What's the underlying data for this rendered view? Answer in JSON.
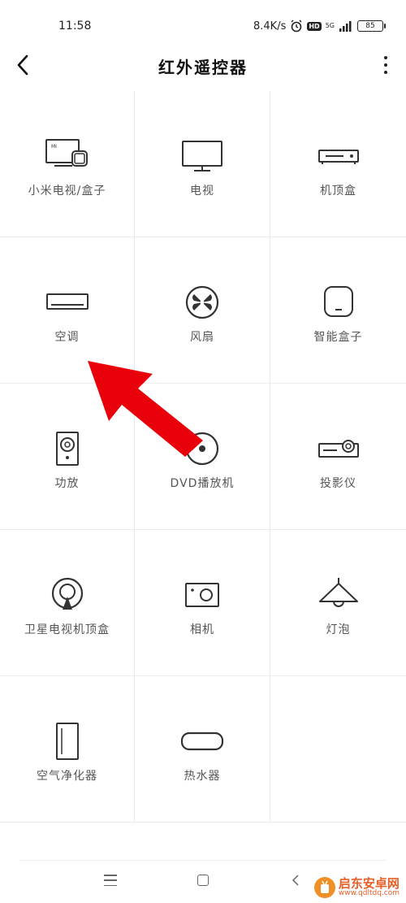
{
  "status_bar": {
    "time": "11:58",
    "net_speed": "8.4K/s",
    "hd": "HD",
    "network": "5G",
    "battery": "85"
  },
  "header": {
    "title": "红外遥控器",
    "back_icon": "back-arrow-icon",
    "more_icon": "more-vertical-icon"
  },
  "devices": [
    {
      "label": "小米电视/盒子",
      "icon": "mi-tv-box-icon"
    },
    {
      "label": "电视",
      "icon": "tv-icon"
    },
    {
      "label": "机顶盒",
      "icon": "set-top-box-icon"
    },
    {
      "label": "空调",
      "icon": "air-conditioner-icon"
    },
    {
      "label": "风扇",
      "icon": "fan-icon"
    },
    {
      "label": "智能盒子",
      "icon": "smart-box-icon"
    },
    {
      "label": "功放",
      "icon": "amplifier-icon"
    },
    {
      "label": "DVD播放机",
      "icon": "dvd-player-icon"
    },
    {
      "label": "投影仪",
      "icon": "projector-icon"
    },
    {
      "label": "卫星电视机顶盒",
      "icon": "satellite-box-icon"
    },
    {
      "label": "相机",
      "icon": "camera-icon"
    },
    {
      "label": "灯泡",
      "icon": "lamp-icon"
    },
    {
      "label": "空气净化器",
      "icon": "air-purifier-icon"
    },
    {
      "label": "热水器",
      "icon": "water-heater-icon"
    }
  ],
  "annotation": {
    "color": "#e8000b",
    "points_to": "空调"
  },
  "watermark": {
    "title": "启东安卓网",
    "url": "www.qdltdq.com"
  }
}
